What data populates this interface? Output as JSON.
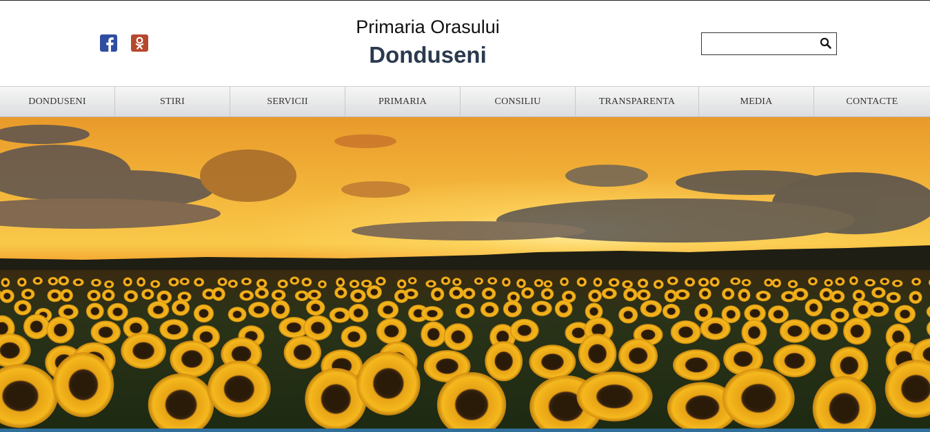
{
  "header": {
    "title_small": "Primaria Orasului",
    "title_big": "Donduseni",
    "search": {
      "placeholder": "",
      "value": "",
      "icon": "search-icon"
    },
    "social": [
      {
        "name": "facebook",
        "icon": "facebook-icon",
        "color": "#2f4ea0"
      },
      {
        "name": "odnoklassniki",
        "icon": "odnoklassniki-icon",
        "color": "#b5492e"
      }
    ]
  },
  "nav": {
    "items": [
      {
        "label": "DONDUSENI"
      },
      {
        "label": "STIRI"
      },
      {
        "label": "SERVICII"
      },
      {
        "label": "PRIMARIA"
      },
      {
        "label": "CONSILIU"
      },
      {
        "label": "TRANSPARENTA"
      },
      {
        "label": "MEDIA"
      },
      {
        "label": "CONTACTE"
      }
    ]
  },
  "hero": {
    "image": "sunflower-field-sunset"
  },
  "colors": {
    "title": "#2b3a4f",
    "bottom_bar": "#2f6f9a",
    "nav_text": "#333333"
  }
}
